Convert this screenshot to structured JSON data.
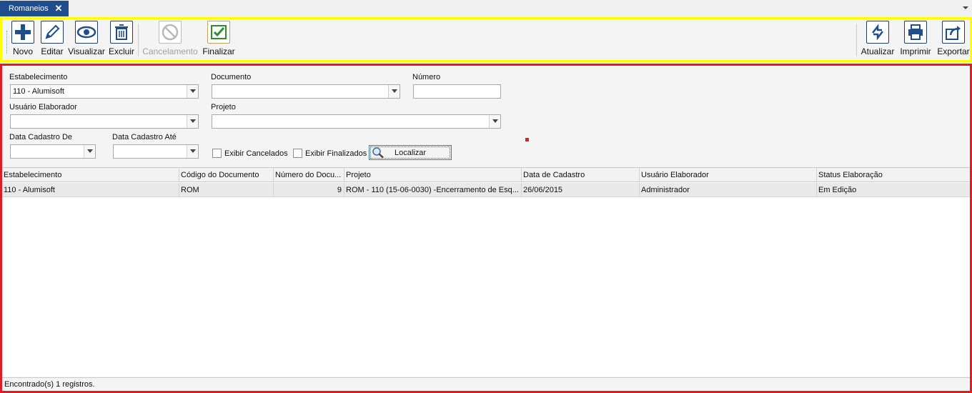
{
  "tab": {
    "title": "Romaneios",
    "close_icon": "close-icon"
  },
  "toolbar": {
    "novo": "Novo",
    "editar": "Editar",
    "visualizar": "Visualizar",
    "excluir": "Excluir",
    "cancelamento": "Cancelamento",
    "finalizar": "Finalizar",
    "atualizar": "Atualizar",
    "imprimir": "Imprimir",
    "exportar": "Exportar"
  },
  "filters": {
    "estabelecimento_label": "Estabelecimento",
    "estabelecimento_value": "110 - Alumisoft",
    "documento_label": "Documento",
    "documento_value": "",
    "numero_label": "Número",
    "numero_value": "",
    "usuario_label": "Usuário Elaborador",
    "usuario_value": "",
    "projeto_label": "Projeto",
    "projeto_value": "",
    "data_de_label": "Data Cadastro De",
    "data_de_value": "",
    "data_ate_label": "Data Cadastro Até",
    "data_ate_value": "",
    "exibir_cancelados": "Exibir Cancelados",
    "exibir_finalizados": "Exibir Finalizados",
    "localizar": "Localizar"
  },
  "grid": {
    "columns": [
      "Estabelecimento",
      "Código do Documento",
      "Número do Docu...",
      "Projeto",
      "Data de Cadastro",
      "Usuário Elaborador",
      "Status Elaboração"
    ],
    "rows": [
      [
        "110 - Alumisoft",
        "ROM",
        "9",
        "ROM - 110 (15-06-0030) -Encerramento de Esq...",
        "26/06/2015",
        "Administrador",
        "Em Edição"
      ]
    ]
  },
  "status": "Encontrado(s) 1 registros.",
  "colors": {
    "tab": "#1f4e8c",
    "toolbar_border": "#ffff00",
    "content_border": "#e31b23"
  }
}
